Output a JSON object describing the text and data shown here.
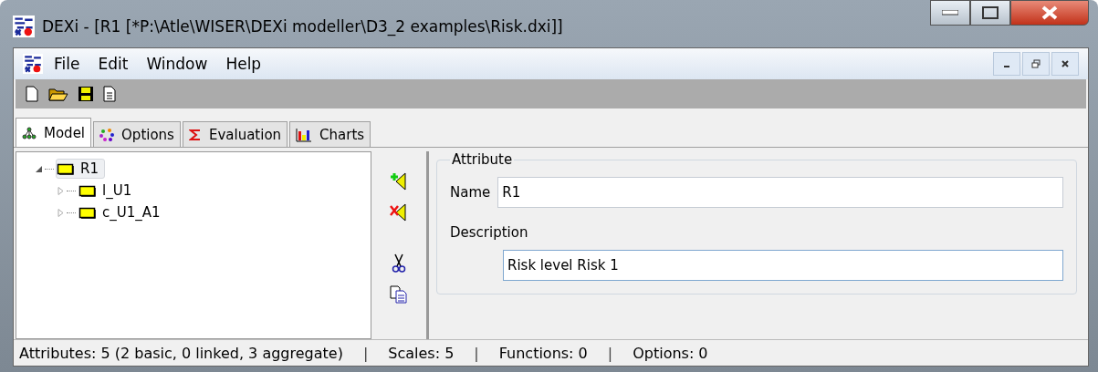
{
  "window": {
    "title": "DEXi - [R1 [*P:\\Atle\\WISER\\DEXi modeller\\D3_2 examples\\Risk.dxi]]"
  },
  "menu": [
    "File",
    "Edit",
    "Window",
    "Help"
  ],
  "tabs": [
    {
      "label": "Model",
      "selected": true
    },
    {
      "label": "Options",
      "selected": false
    },
    {
      "label": "Evaluation",
      "selected": false
    },
    {
      "label": "Charts",
      "selected": false
    }
  ],
  "tree": [
    {
      "label": "R1",
      "selected": true,
      "expanded": true,
      "children": [
        {
          "label": "l_U1",
          "selected": false,
          "expanded": false
        },
        {
          "label": "c_U1_A1",
          "selected": false,
          "expanded": false
        }
      ]
    }
  ],
  "attribute": {
    "title": "Attribute",
    "name_label": "Name",
    "name_value": "R1",
    "description_label": "Description",
    "description_value": "Risk level Risk 1"
  },
  "status_bar": [
    {
      "kind": "text",
      "text": "Attributes: 5 (2 basic, 0 linked, 3 aggregate)"
    },
    {
      "kind": "separator",
      "text": "|"
    },
    {
      "kind": "text",
      "text": "Scales: 5"
    },
    {
      "kind": "separator",
      "text": "|"
    },
    {
      "kind": "text",
      "text": "Functions: 0"
    },
    {
      "kind": "separator",
      "text": "|"
    },
    {
      "kind": "text",
      "text": "Options: 0"
    }
  ]
}
